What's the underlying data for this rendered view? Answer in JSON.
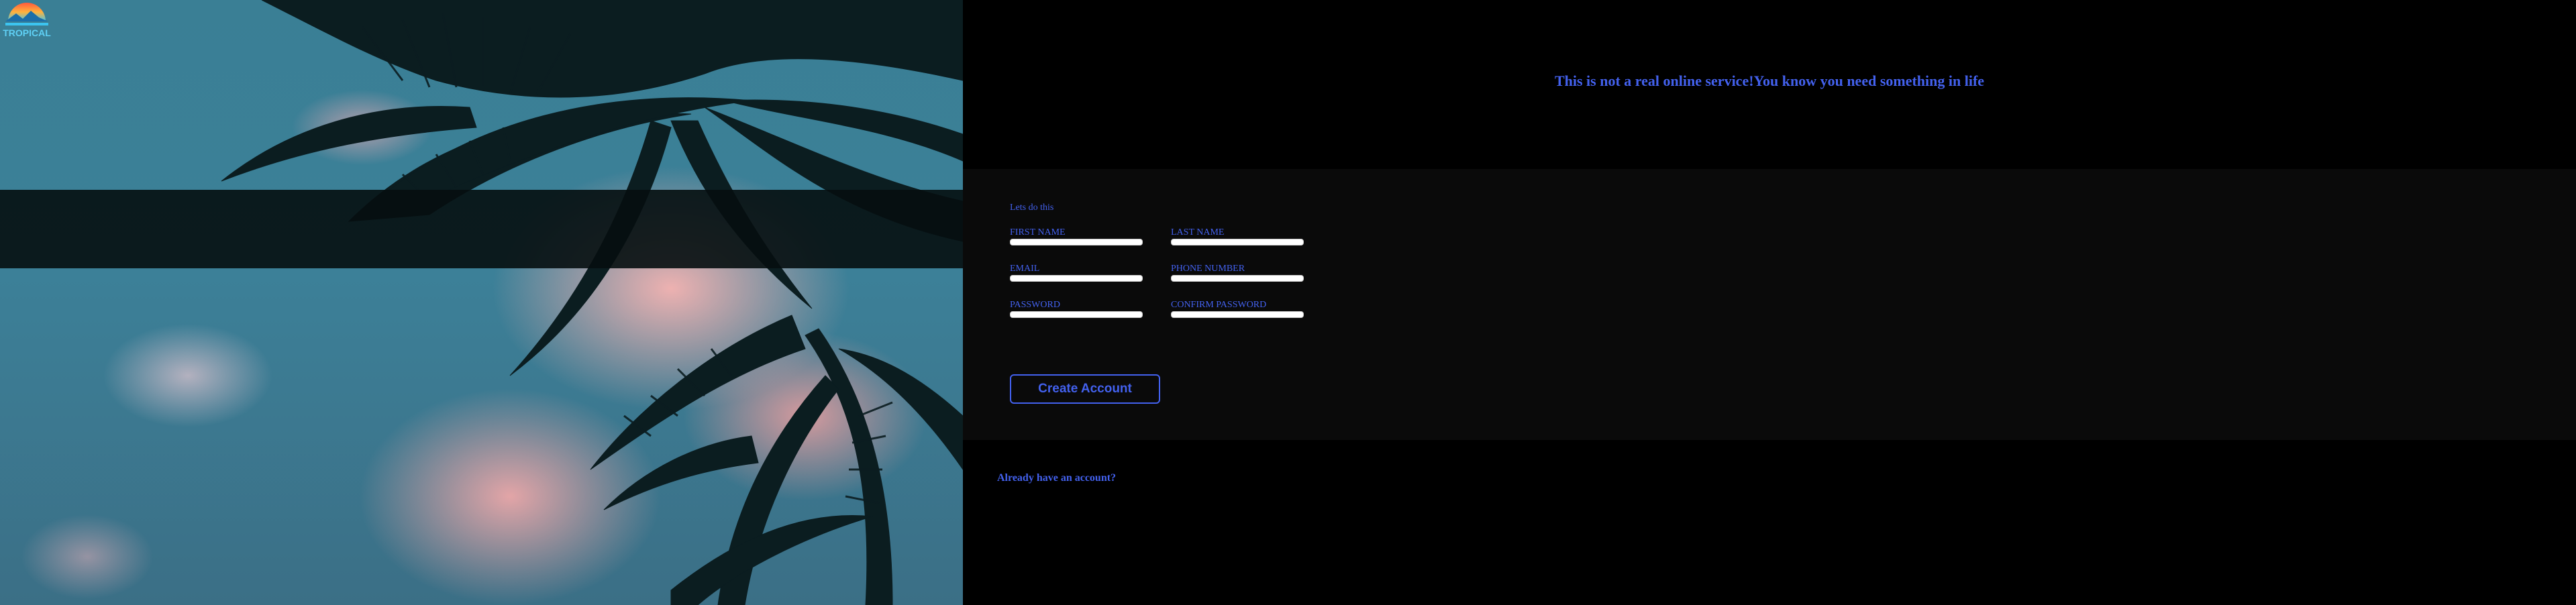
{
  "hero": {
    "logo_text": "TROPICAL",
    "colors": {
      "sky": "#3a7f95",
      "cloud": "#f7b4b2",
      "band": "#060e10"
    }
  },
  "headline": "This is not a real online service!You know you need something in life",
  "form": {
    "title": "Lets do this",
    "fields": {
      "first_name": {
        "label": "FIRST NAME",
        "value": ""
      },
      "last_name": {
        "label": "LAST NAME",
        "value": ""
      },
      "email": {
        "label": "EMAIL",
        "value": ""
      },
      "phone": {
        "label": "PHONE NUMBER",
        "value": ""
      },
      "password": {
        "label": "PASSWORD",
        "value": ""
      },
      "confirm_password": {
        "label": "CONFIRM PASSWORD",
        "value": ""
      }
    },
    "submit_label": "Create Account"
  },
  "login_link": "Already have an account?",
  "colors": {
    "accent": "#4361ee",
    "background": "#000000",
    "panel": "#0a0a0a"
  }
}
